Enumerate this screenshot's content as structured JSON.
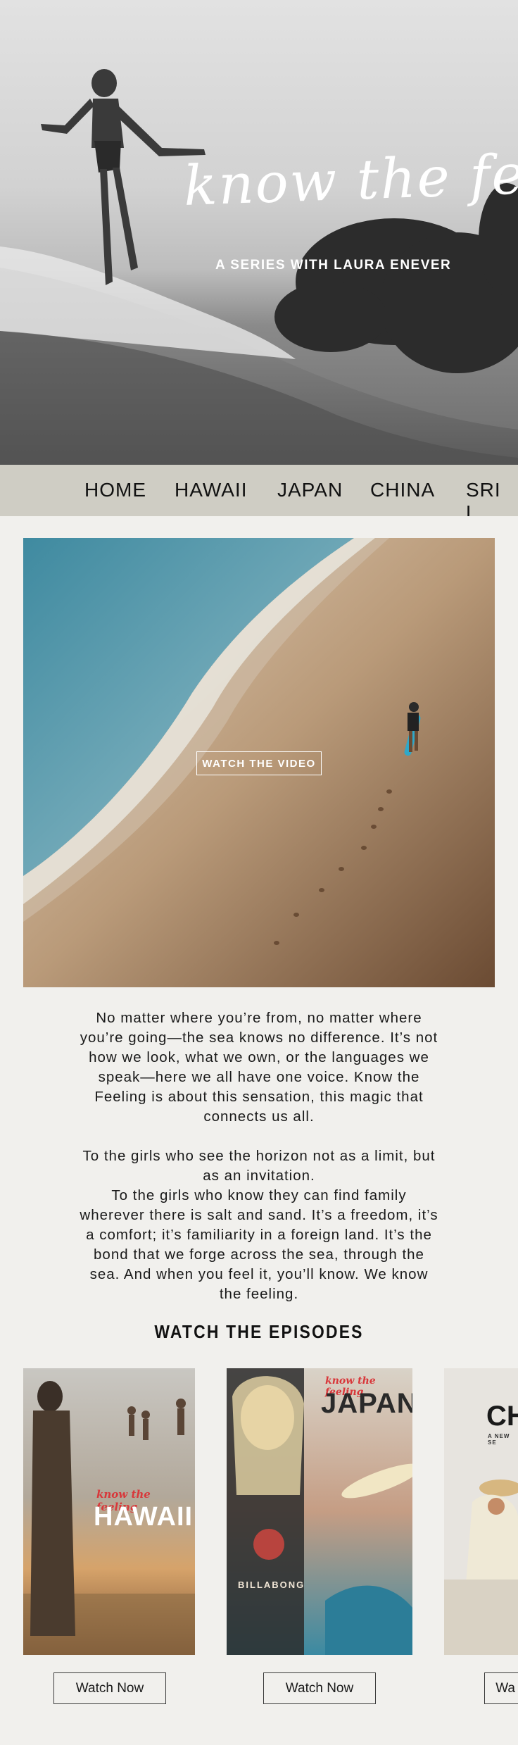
{
  "hero": {
    "title": "know the feeling",
    "subtitle": "A SERIES WITH LAURA ENEVER"
  },
  "nav": {
    "items": [
      {
        "label": "HOME"
      },
      {
        "label": "HAWAII"
      },
      {
        "label": "JAPAN"
      },
      {
        "label": "CHINA"
      },
      {
        "label": "SRI L"
      }
    ]
  },
  "video": {
    "button_label": "WATCH THE VIDEO"
  },
  "intro": {
    "paragraph_1": "No matter where you’re from, no matter where you’re going—the sea knows no difference. It’s not how we look, what we own, or the languages we speak—here we all have one voice. Know the Feeling is about this sensation, this magic that connects us all.",
    "paragraph_2_line_1": "To the girls who see the horizon not as a limit, but as an invitation.",
    "paragraph_2_line_2": "To the girls who know they can find family wherever there is salt and sand. It’s a freedom, it’s a comfort; it’s familiarity in a foreign land. It’s the bond that we forge across the sea, through the sea. And when you feel it, you’ll know. We know the feeling."
  },
  "episodes": {
    "heading": "WATCH THE EPISODES",
    "items": [
      {
        "poster_title": "HAWAII",
        "poster_script": "know the feeling",
        "poster_brand": "",
        "button_label": "Watch Now"
      },
      {
        "poster_title": "JAPAN",
        "poster_script": "know the feeling",
        "poster_brand": "BILLABONG",
        "button_label": "Watch Now"
      },
      {
        "poster_title": "CH",
        "poster_script": "",
        "poster_brand": "A NEW SE",
        "button_label": "Wa"
      }
    ]
  },
  "colors": {
    "page_bg": "#f1f0ed",
    "nav_bg": "#cfcdc4",
    "accent_red": "#d8373a"
  }
}
